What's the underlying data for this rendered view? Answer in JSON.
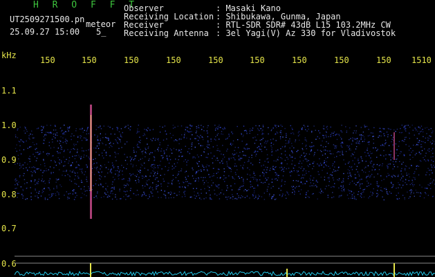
{
  "header": {
    "app_title": "H R O F F T",
    "filename": "UT2509271500.pn",
    "mode": "meteor",
    "datetime": "25.09.27 15:00",
    "small": "5_"
  },
  "info": [
    {
      "label": "Observer",
      "value": ": Masaki Kano"
    },
    {
      "label": "Receiving Location",
      "value": ": Shibukawa, Gunma, Japan"
    },
    {
      "label": "Receiver",
      "value": ": RTL-SDR SDR# 43dB L15 103.2MHz CW"
    },
    {
      "label": "Receiving Antenna",
      "value": ": 3el Yagi(V) Az 330 for Vladivostok"
    }
  ],
  "axis": {
    "freq_unit": "kHz",
    "freq_ticks": [
      "150",
      "150",
      "150",
      "150",
      "150",
      "150",
      "150",
      "150",
      "150",
      "1510"
    ],
    "level_ticks": [
      "1.1",
      "1.0",
      "0.9",
      "0.8",
      "0.7",
      "0.6"
    ]
  },
  "colors": {
    "label_green": "#3ec63e",
    "text_white": "#e8e8e8",
    "axis_yellow": "#e6e64a",
    "noise_blue": "#2b3ec8",
    "trace_cyan": "#22c8e8"
  }
}
